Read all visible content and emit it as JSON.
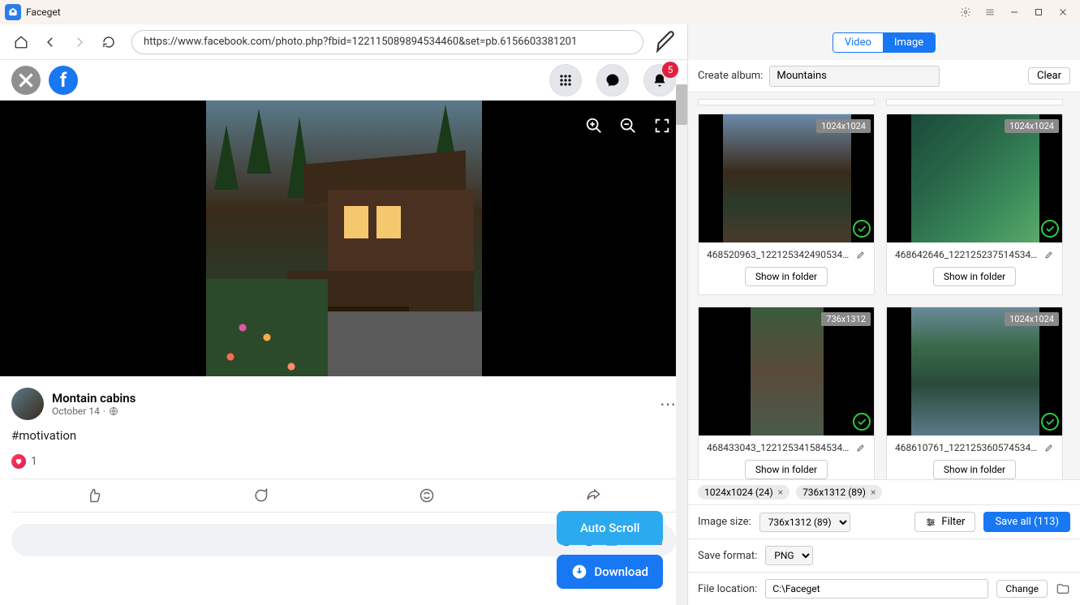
{
  "app": {
    "title": "Faceget"
  },
  "browser": {
    "url": "https://www.facebook.com/photo.php?fbid=122115089894534460&set=pb.6156603381201"
  },
  "fb": {
    "notification_count": "5",
    "post": {
      "page_name": "Montain cabins",
      "date": "October 14",
      "caption": "#motivation",
      "reaction_count": "1"
    }
  },
  "float": {
    "auto_scroll": "Auto Scroll",
    "download": "Download"
  },
  "panel": {
    "tabs": {
      "video": "Video",
      "image": "Image"
    },
    "album_label": "Create album:",
    "album_value": "Mountains",
    "clear": "Clear",
    "cards": [
      {
        "dim": "1024x1024",
        "name": "468520963_122125342490534460_...",
        "show": "Show in folder"
      },
      {
        "dim": "1024x1024",
        "name": "468642646_122125237514534460_...",
        "show": "Show in folder"
      },
      {
        "dim": "736x1312",
        "name": "468433043_122125341584534460_...",
        "show": "Show in folder"
      },
      {
        "dim": "1024x1024",
        "name": "468610761_122125360574534460_...",
        "show": "Show in folder"
      }
    ],
    "chips": [
      {
        "label": "1024x1024 (24)"
      },
      {
        "label": "736x1312 (89)"
      }
    ],
    "image_size_label": "Image size:",
    "image_size_value": "736x1312 (89)",
    "filter": "Filter",
    "save_all": "Save all (113)",
    "save_format_label": "Save format:",
    "save_format_value": "PNG",
    "file_location_label": "File location:",
    "file_location_value": "C:\\Faceget",
    "change": "Change"
  }
}
